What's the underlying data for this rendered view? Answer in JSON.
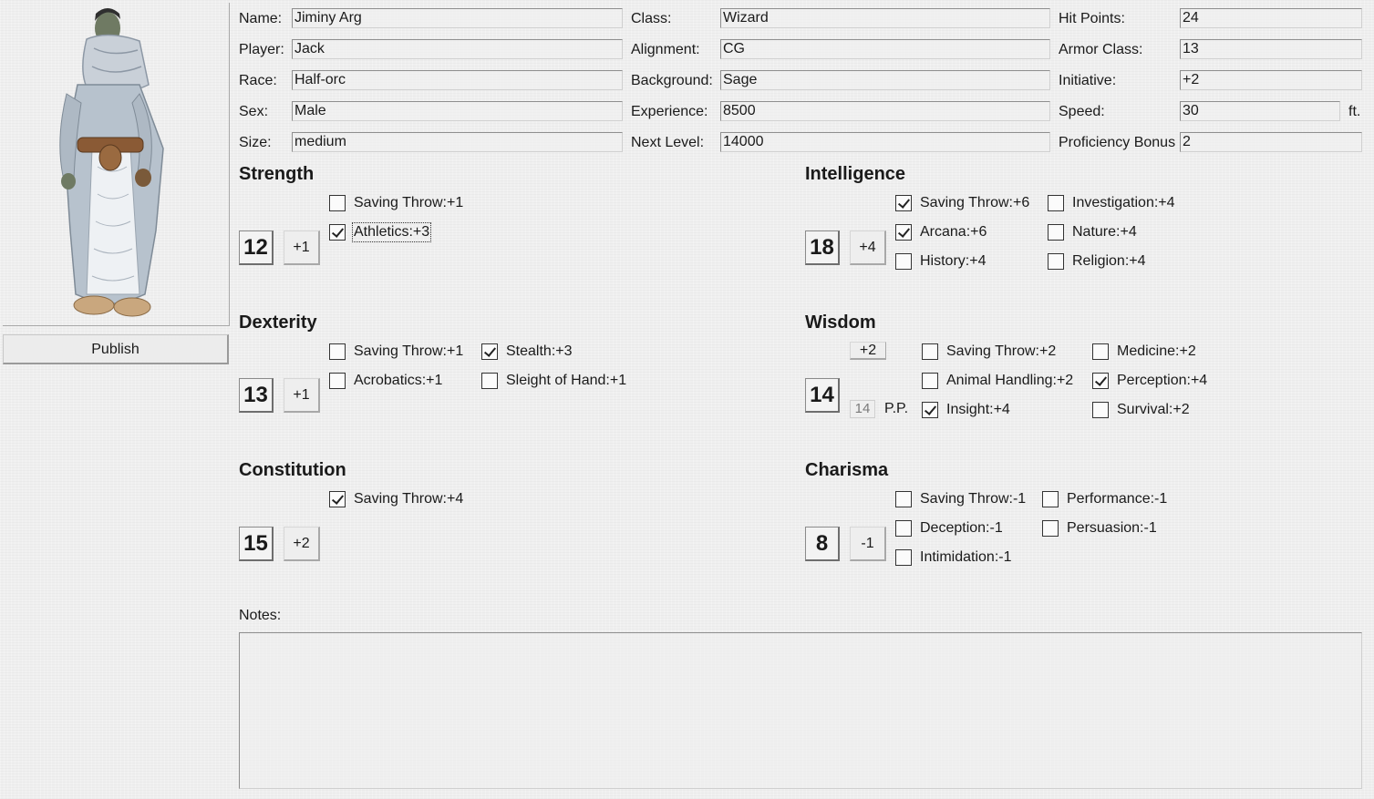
{
  "portrait": {
    "publish_label": "Publish"
  },
  "info": {
    "name": {
      "label": "Name:",
      "value": "Jiminy Arg"
    },
    "player": {
      "label": "Player:",
      "value": "Jack"
    },
    "race": {
      "label": "Race:",
      "value": "Half-orc"
    },
    "sex": {
      "label": "Sex:",
      "value": "Male"
    },
    "size": {
      "label": "Size:",
      "value": "medium"
    },
    "class": {
      "label": "Class:",
      "value": "Wizard"
    },
    "alignment": {
      "label": "Alignment:",
      "value": "CG"
    },
    "background": {
      "label": "Background:",
      "value": "Sage"
    },
    "experience": {
      "label": "Experience:",
      "value": "8500"
    },
    "next_level": {
      "label": "Next Level:",
      "value": "14000"
    },
    "hit_points": {
      "label": "Hit Points:",
      "value": "24"
    },
    "armor_class": {
      "label": "Armor Class:",
      "value": "13"
    },
    "initiative": {
      "label": "Initiative:",
      "value": "+2"
    },
    "speed": {
      "label": "Speed:",
      "value": "30",
      "unit": "ft."
    },
    "proficiency": {
      "label": "Proficiency Bonus",
      "value": "2"
    }
  },
  "abilities": {
    "strength": {
      "title": "Strength",
      "score": "12",
      "mod": "+1",
      "skills": [
        {
          "label": "Saving Throw:+1",
          "checked": false
        },
        {
          "label": "Athletics:+3",
          "checked": true
        }
      ]
    },
    "dexterity": {
      "title": "Dexterity",
      "score": "13",
      "mod": "+1",
      "skills": [
        {
          "label": "Saving Throw:+1",
          "checked": false
        },
        {
          "label": "Stealth:+3",
          "checked": true
        },
        {
          "label": "Acrobatics:+1",
          "checked": false
        },
        {
          "label": "Sleight of Hand:+1",
          "checked": false
        }
      ]
    },
    "constitution": {
      "title": "Constitution",
      "score": "15",
      "mod": "+2",
      "skills": [
        {
          "label": "Saving Throw:+4",
          "checked": true
        }
      ]
    },
    "intelligence": {
      "title": "Intelligence",
      "score": "18",
      "mod": "+4",
      "skills": [
        {
          "label": "Saving Throw:+6",
          "checked": true
        },
        {
          "label": "Investigation:+4",
          "checked": false
        },
        {
          "label": "Arcana:+6",
          "checked": true
        },
        {
          "label": "Nature:+4",
          "checked": false
        },
        {
          "label": "History:+4",
          "checked": false
        },
        {
          "label": "Religion:+4",
          "checked": false
        }
      ]
    },
    "wisdom": {
      "title": "Wisdom",
      "score": "14",
      "mod": "+2",
      "pp_value": "14",
      "pp_label": "P.P.",
      "skills": [
        {
          "label": "Saving Throw:+2",
          "checked": false
        },
        {
          "label": "Medicine:+2",
          "checked": false
        },
        {
          "label": "Animal Handling:+2",
          "checked": false
        },
        {
          "label": "Perception:+4",
          "checked": true
        },
        {
          "label": "Insight:+4",
          "checked": true
        },
        {
          "label": "Survival:+2",
          "checked": false
        }
      ]
    },
    "charisma": {
      "title": "Charisma",
      "score": "8",
      "mod": "-1",
      "skills": [
        {
          "label": "Saving Throw:-1",
          "checked": false
        },
        {
          "label": "Performance:-1",
          "checked": false
        },
        {
          "label": "Deception:-1",
          "checked": false
        },
        {
          "label": "Persuasion:-1",
          "checked": false
        },
        {
          "label": "Intimidation:-1",
          "checked": false
        }
      ]
    }
  },
  "notes": {
    "label": "Notes:",
    "value": ""
  }
}
